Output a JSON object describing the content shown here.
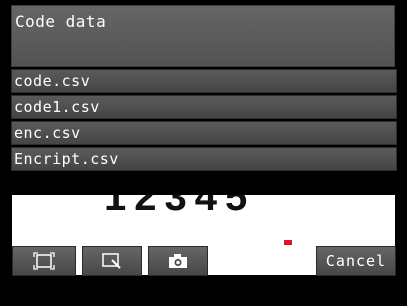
{
  "header": {
    "title": "Code data"
  },
  "files": [
    {
      "label": "code.csv"
    },
    {
      "label": "code1.csv"
    },
    {
      "label": "enc.csv"
    },
    {
      "label": "Encript.csv"
    }
  ],
  "image": {
    "ocr_text": "12345"
  },
  "toolbar": {
    "frame_icon": "frame-icon",
    "zoom_icon": "zoom-icon",
    "capture_icon": "camera-icon",
    "cancel_label": "Cancel"
  },
  "colors": {
    "panel": "#5a5a5a",
    "marker": "#e0102a"
  }
}
